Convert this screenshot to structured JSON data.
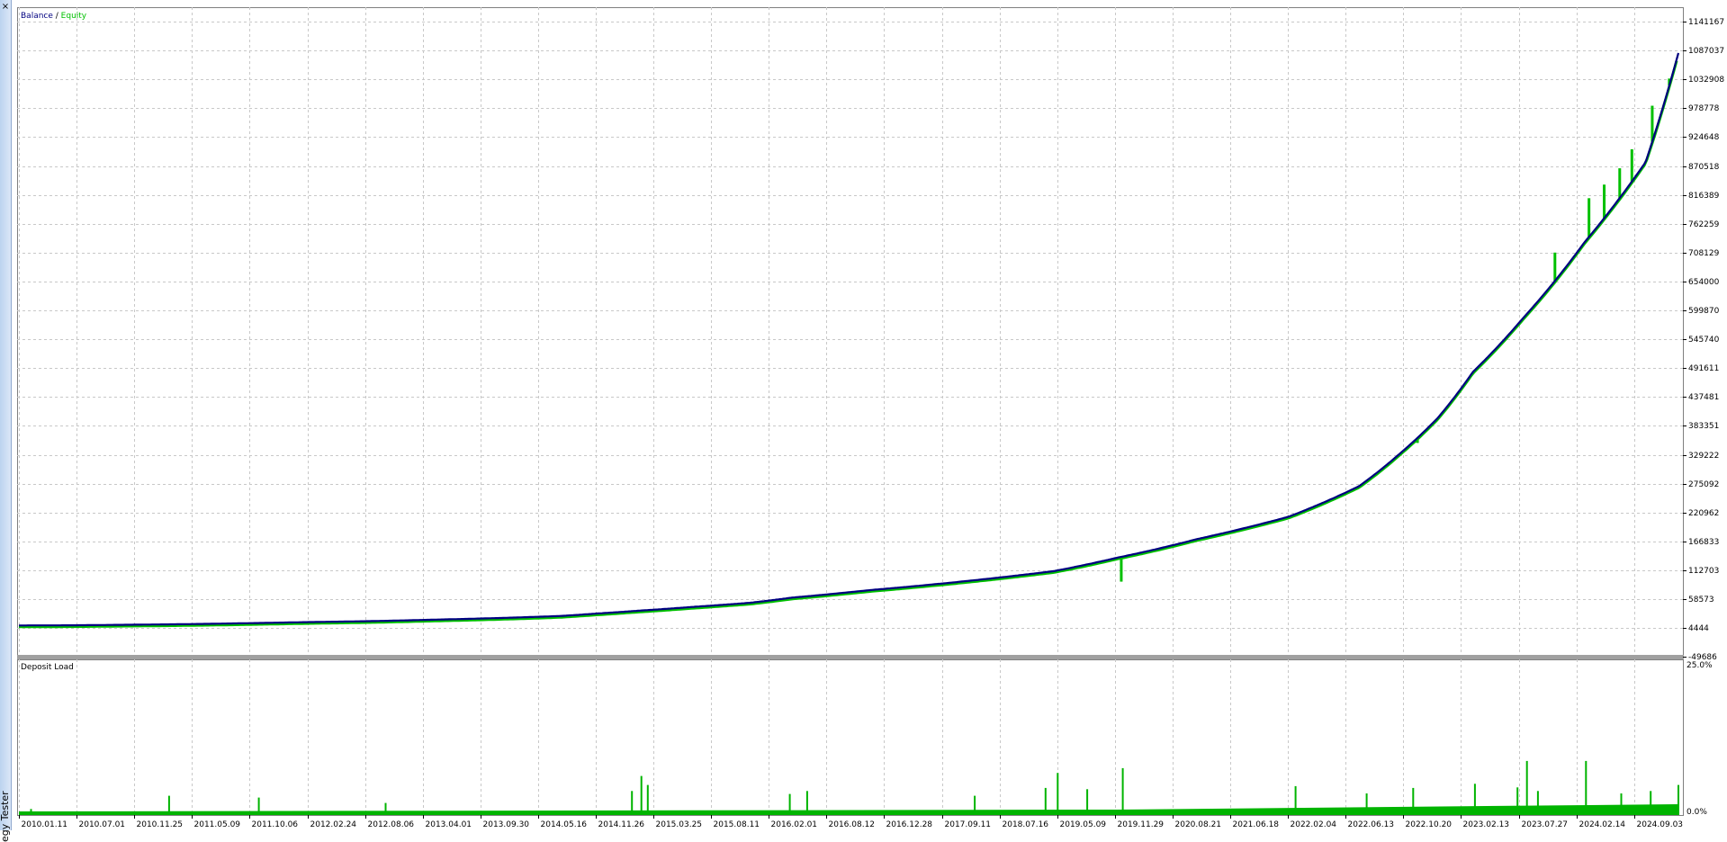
{
  "window": {
    "panel_title": "egy Tester",
    "close_glyph": "×"
  },
  "colors": {
    "balance": "#000080",
    "equity": "#00c000",
    "deposit_load": "#00b400",
    "grid": "#c8c8c8",
    "frame": "#808080"
  },
  "chart_data": [
    {
      "type": "line",
      "legend": [
        "Balance",
        "Equity"
      ],
      "legend_separator": " / ",
      "legend_position": "top-left",
      "y_ticks": [
        "1141167",
        "1087037",
        "1032908",
        "978778",
        "924648",
        "870518",
        "816389",
        "762259",
        "708129",
        "654000",
        "599870",
        "545740",
        "491611",
        "437481",
        "383351",
        "329222",
        "275092",
        "220962",
        "166833",
        "112703",
        "58573",
        "4444",
        "-49686"
      ],
      "ylim": [
        -49686,
        1141167
      ],
      "grid": true,
      "x_ticks": [
        "2010.01.11",
        "2010.07.01",
        "2010.11.25",
        "2011.05.09",
        "2011.10.06",
        "2012.02.24",
        "2012.08.06",
        "2013.04.01",
        "2013.09.30",
        "2014.05.16",
        "2014.11.26",
        "2015.03.25",
        "2015.08.11",
        "2016.02.01",
        "2016.08.12",
        "2016.12.28",
        "2017.09.11",
        "2018.07.16",
        "2019.05.09",
        "2019.11.29",
        "2020.08.21",
        "2021.06.18",
        "2022.02.04",
        "2022.06.13",
        "2022.10.20",
        "2023.02.13",
        "2023.07.27",
        "2024.02.14",
        "2024.09.03"
      ],
      "series": [
        {
          "name": "Balance",
          "x": [
            "2010.01.11",
            "2010.07.01",
            "2010.11.25",
            "2011.05.09",
            "2011.10.06",
            "2012.02.24",
            "2012.08.06",
            "2013.04.01",
            "2013.09.30",
            "2014.05.16",
            "2014.11.26",
            "2015.03.25",
            "2015.08.11",
            "2016.02.01",
            "2016.08.12",
            "2016.12.28",
            "2017.09.11",
            "2018.07.16",
            "2019.05.09",
            "2019.11.29",
            "2020.08.21",
            "2021.06.18",
            "2022.02.04",
            "2022.06.13",
            "2022.10.20",
            "2023.02.13",
            "2023.07.27",
            "2024.02.14",
            "2024.09.03",
            "2024.12.20"
          ],
          "values": [
            4444,
            4700,
            5500,
            6400,
            7500,
            8800,
            10500,
            12600,
            15000,
            18200,
            21800,
            26300,
            31600,
            38400,
            46200,
            55700,
            69500,
            85600,
            104500,
            128700,
            163300,
            204500,
            260600,
            318000,
            385500,
            470400,
            568700,
            708100,
            856200,
            1057000
          ]
        },
        {
          "name": "Equity",
          "dips": [
            {
              "x": "2019.12.15",
              "value": 85000
            },
            {
              "x": "2024.03.01",
              "value": 790000
            },
            {
              "x": "2024.04.20",
              "value": 815000
            },
            {
              "x": "2024.06.10",
              "value": 845000
            },
            {
              "x": "2024.07.20",
              "value": 880000
            },
            {
              "x": "2024.09.25",
              "value": 960000
            },
            {
              "x": "2024.11.20",
              "value": 1010000
            },
            {
              "x": "2023.11.10",
              "value": 690000
            },
            {
              "x": "2022.08.15",
              "value": 340000
            }
          ]
        }
      ]
    },
    {
      "type": "bar",
      "title": "Deposit Load",
      "y_ticks": [
        "25.0%",
        "0.0%"
      ],
      "ylim": [
        0,
        25
      ],
      "x_ticks": [
        "2010.01.11",
        "2010.07.01",
        "2010.11.25",
        "2011.05.09",
        "2011.10.06",
        "2012.02.24",
        "2012.08.06",
        "2013.04.01",
        "2013.09.30",
        "2014.05.16",
        "2014.11.26",
        "2015.03.25",
        "2015.08.11",
        "2016.02.01",
        "2016.08.12",
        "2016.12.28",
        "2017.09.11",
        "2018.07.16",
        "2019.05.09",
        "2019.11.29",
        "2020.08.21",
        "2021.06.18",
        "2022.02.04",
        "2022.06.13",
        "2022.10.20",
        "2023.02.13",
        "2023.07.27",
        "2024.02.14",
        "2024.09.03"
      ],
      "baseline_band": {
        "x": [
          "2010.01.11",
          "2019.11.29",
          "2024.12.20"
        ],
        "values": [
          0.6,
          0.9,
          1.8
        ]
      },
      "spikes": [
        {
          "x": "2010.02.20",
          "value": 1.0
        },
        {
          "x": "2011.05.20",
          "value": 3.2
        },
        {
          "x": "2012.03.10",
          "value": 2.9
        },
        {
          "x": "2013.05.01",
          "value": 2.0
        },
        {
          "x": "2015.07.20",
          "value": 4.0
        },
        {
          "x": "2015.08.20",
          "value": 6.5
        },
        {
          "x": "2015.09.10",
          "value": 5.0
        },
        {
          "x": "2016.12.20",
          "value": 3.5
        },
        {
          "x": "2017.02.15",
          "value": 4.0
        },
        {
          "x": "2018.08.20",
          "value": 3.2
        },
        {
          "x": "2019.04.10",
          "value": 4.5
        },
        {
          "x": "2019.05.20",
          "value": 7.0
        },
        {
          "x": "2019.08.25",
          "value": 4.3
        },
        {
          "x": "2019.12.20",
          "value": 7.8
        },
        {
          "x": "2021.07.10",
          "value": 4.8
        },
        {
          "x": "2022.03.01",
          "value": 3.6
        },
        {
          "x": "2022.08.01",
          "value": 4.5
        },
        {
          "x": "2023.02.20",
          "value": 5.2
        },
        {
          "x": "2023.07.10",
          "value": 4.6
        },
        {
          "x": "2023.08.10",
          "value": 9.0
        },
        {
          "x": "2023.09.15",
          "value": 4.0
        },
        {
          "x": "2024.02.20",
          "value": 9.0
        },
        {
          "x": "2024.06.15",
          "value": 3.6
        },
        {
          "x": "2024.09.20",
          "value": 4.0
        },
        {
          "x": "2024.12.20",
          "value": 5.0
        }
      ]
    }
  ]
}
